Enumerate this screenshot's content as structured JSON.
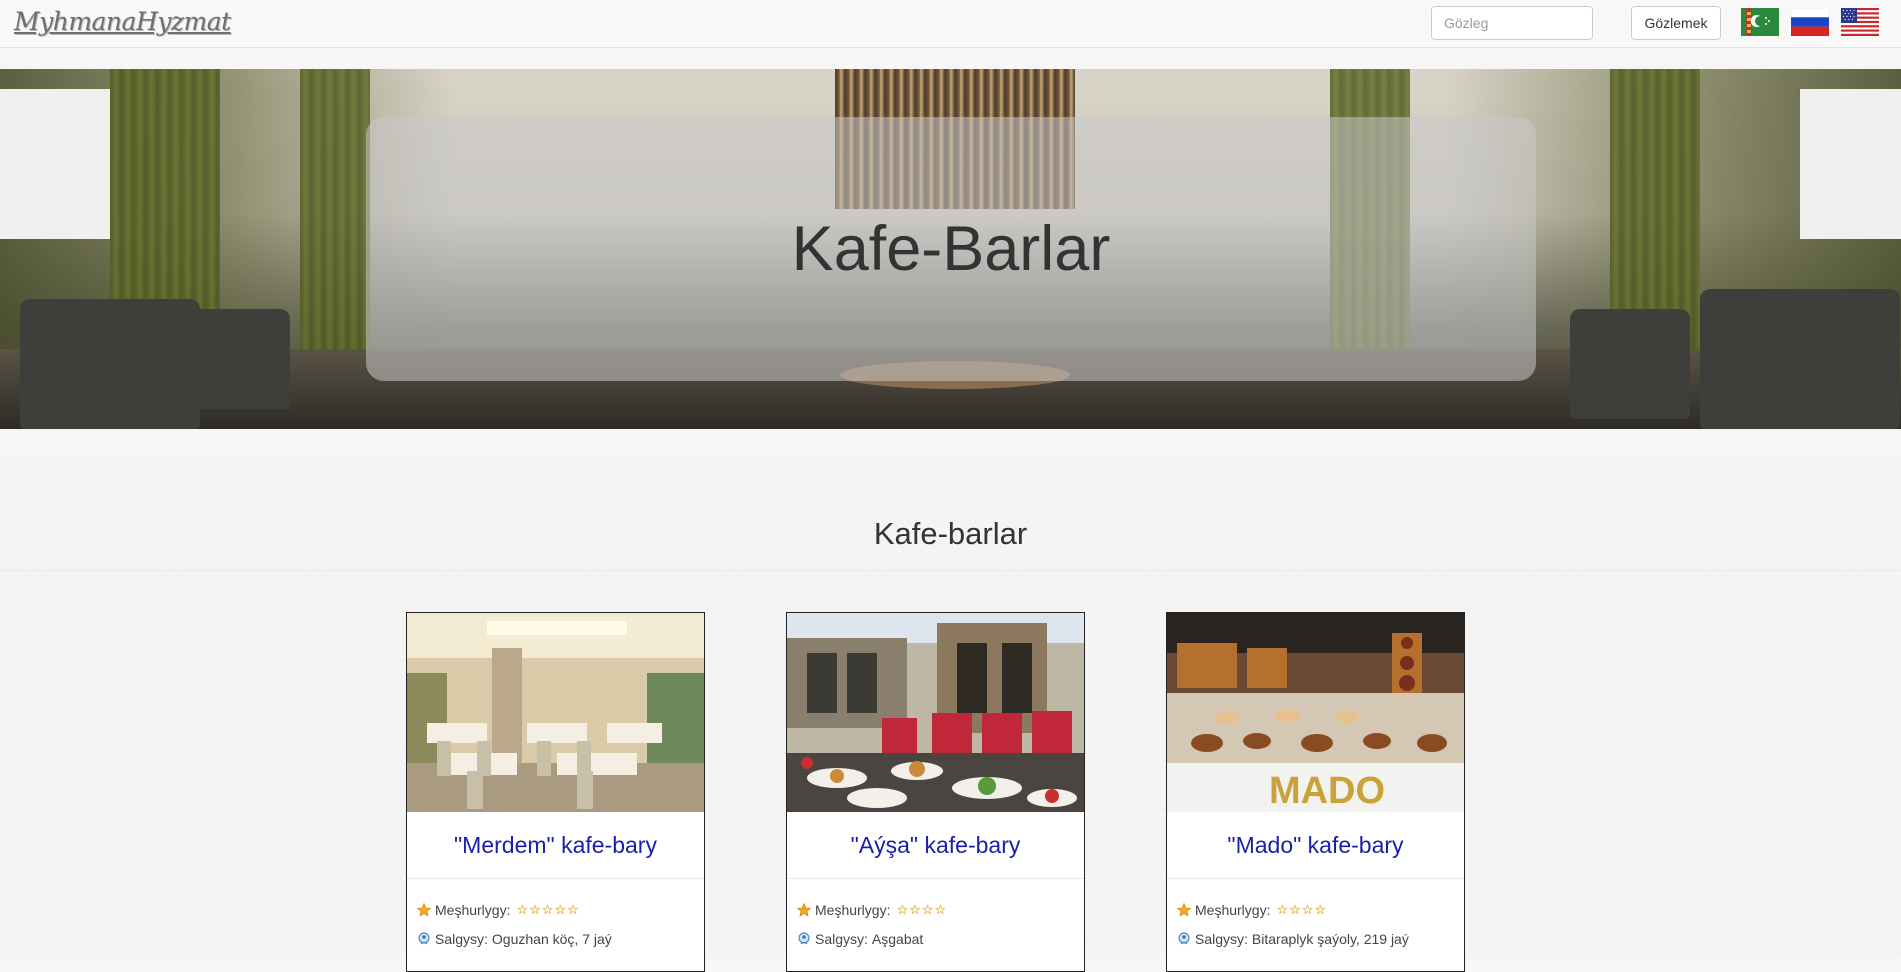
{
  "navbar": {
    "brand": "MyhmanaHyzmat",
    "search_placeholder": "Gözleg",
    "search_button": "Gözlemek",
    "flags": [
      "turkmenistan-flag",
      "russia-flag",
      "usa-flag"
    ]
  },
  "hero": {
    "title": "Kafe-Barlar"
  },
  "section": {
    "title": "Kafe-barlar"
  },
  "cards": [
    {
      "name": "\"Merdem\" kafe-bary",
      "popularity_label": "Meşhurlygy:",
      "rating": 5,
      "address_label": "Salgysy:",
      "address": "Oguzhan köç, 7 jaý"
    },
    {
      "name": "\"Aýşa\" kafe-bary",
      "popularity_label": "Meşhurlygy:",
      "rating": 4,
      "address_label": "Salgysy:",
      "address": "Aşgabat"
    },
    {
      "name": "\"Mado\" kafe-bary",
      "popularity_label": "Meşhurlygy:",
      "rating": 4,
      "address_label": "Salgysy:",
      "address": "Bitaraplyk şaýoly, 219 jaý"
    }
  ],
  "colors": {
    "link": "#1a1fa8",
    "star": "#f0b020"
  }
}
